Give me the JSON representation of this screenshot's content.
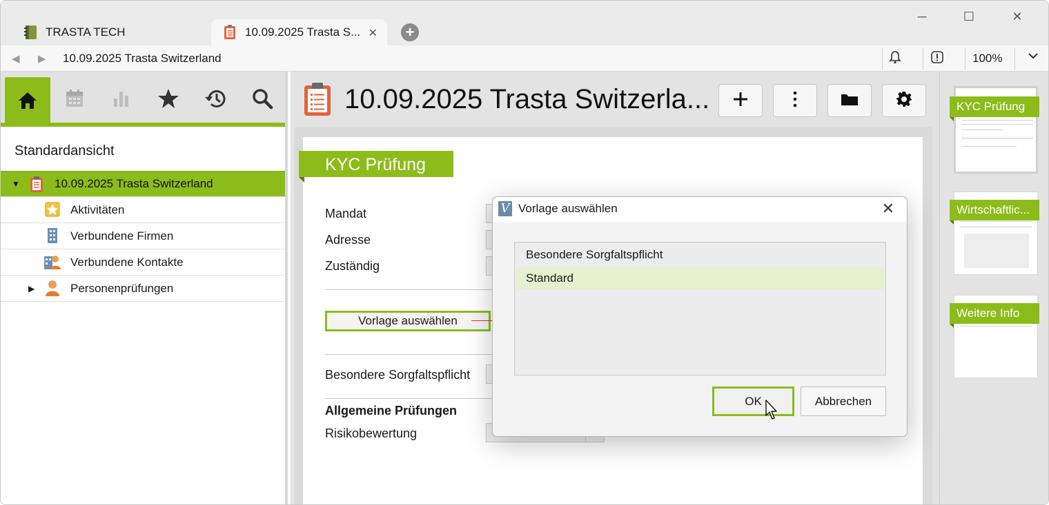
{
  "tabs": [
    {
      "label": "TRASTA TECH",
      "active": false
    },
    {
      "label": "10.09.2025 Trasta S...",
      "active": true
    }
  ],
  "window_controls": {
    "minimize": "─",
    "maximize": "☐",
    "close": "✕"
  },
  "address": {
    "title": "10.09.2025 Trasta Switzerland",
    "zoom": "100%"
  },
  "left_nav": {
    "buttons": [
      "home-icon",
      "calendar-icon",
      "chart-icon",
      "star-icon",
      "history-icon",
      "search-icon"
    ],
    "view_title": "Standardansicht",
    "tree": [
      {
        "label": "10.09.2025 Trasta Switzerland",
        "level": 0,
        "expanded": true,
        "selected": true,
        "icon": "clipboard-icon"
      },
      {
        "label": "Aktivitäten",
        "level": 1,
        "icon": "activity-star-icon"
      },
      {
        "label": "Verbundene Firmen",
        "level": 1,
        "icon": "building-icon"
      },
      {
        "label": "Verbundene Kontakte",
        "level": 1,
        "icon": "contacts-icon"
      },
      {
        "label": "Personenprüfungen",
        "level": 1,
        "collapsed": true,
        "icon": "person-icon"
      }
    ]
  },
  "main": {
    "title": "10.09.2025 Trasta Switzerla...",
    "toolbar": [
      "plus-icon",
      "more-icon",
      "folder-icon",
      "gear-icon"
    ],
    "section": "KYC Prüfung",
    "fields": {
      "mandat": "Mandat",
      "adresse": "Adresse",
      "zustaendig": "Zuständig",
      "vorlage_button": "Vorlage auswählen",
      "sorgfalt": "Besondere Sorgfaltspflicht",
      "allgemein": "Allgemeine Prüfungen",
      "risiko": "Risikobewertung"
    }
  },
  "dialog": {
    "title": "Vorlage auswählen",
    "items": [
      {
        "label": "Besondere Sorgfaltspflicht",
        "selected": false
      },
      {
        "label": "Standard",
        "selected": true
      }
    ],
    "ok": "OK",
    "cancel": "Abbrechen"
  },
  "thumbnails": [
    {
      "label": "KYC Prüfung",
      "active": true
    },
    {
      "label": "Wirtschaftlic...",
      "active": false
    },
    {
      "label": "Weitere Info",
      "active": false
    }
  ],
  "colors": {
    "accent": "#8cbc1a",
    "accent_dark": "#5d7d10",
    "arrow": "#e53030"
  }
}
